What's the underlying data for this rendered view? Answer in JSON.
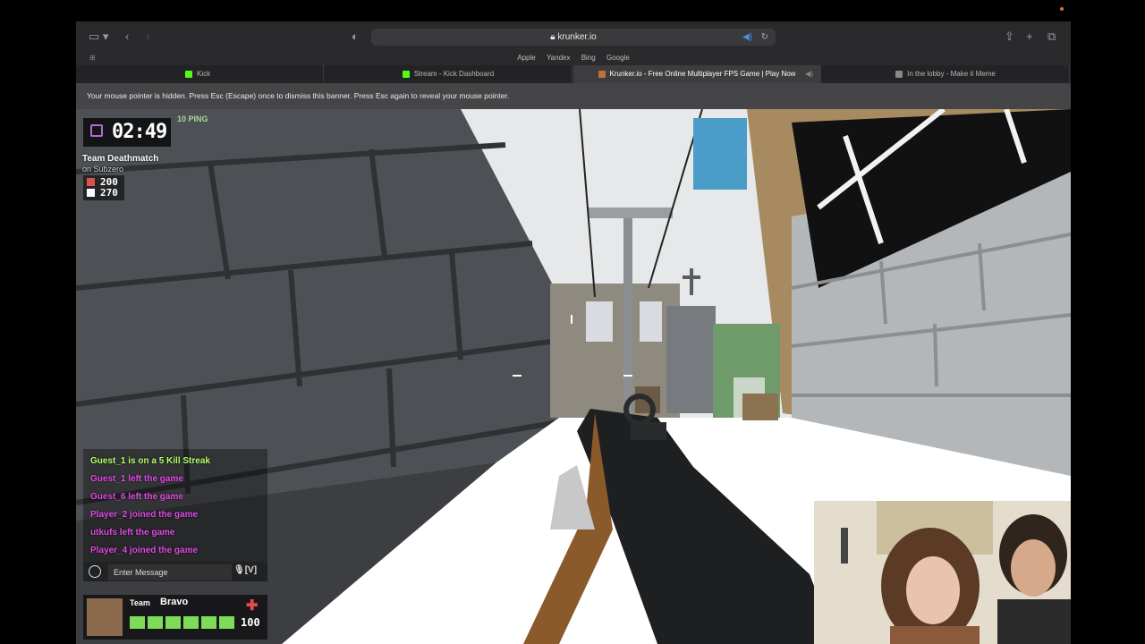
{
  "browser": {
    "url": "krunker.io",
    "favorites": [
      "Apple",
      "Yandex",
      "Bing",
      "Google"
    ],
    "tabs": [
      {
        "label": "Kick",
        "icon": "kick-icon",
        "active": false
      },
      {
        "label": "Stream - Kick Dashboard",
        "icon": "kick-icon",
        "active": false
      },
      {
        "label": "Krunker.io - Free Online Multiplayer FPS Game | Play Now",
        "icon": "krunker-icon",
        "active": true
      },
      {
        "label": "In the lobby - Make it Meme",
        "icon": "meme-icon",
        "active": false
      }
    ],
    "banner": "Your mouse pointer is hidden. Press Esc (Escape) once to dismiss this banner. Press Esc again to reveal your mouse pointer."
  },
  "game": {
    "timer": "02:49",
    "ping": "10 PING",
    "mode": "Team Deathmatch",
    "map": "on Subzero",
    "scores": [
      {
        "team": "red",
        "value": "200",
        "color": "#d9534f"
      },
      {
        "team": "white",
        "value": "270",
        "color": "#ffffff"
      }
    ],
    "feed": [
      {
        "text": "Guest_1 is on a 5 Kill Streak",
        "color": "#b6ff6a"
      },
      {
        "text": "Guest_1 left the game",
        "color": "#e24be6"
      },
      {
        "text": "Guest_6 left the game",
        "color": "#e24be6"
      },
      {
        "text": "Player_2 joined the game",
        "color": "#e24be6"
      },
      {
        "text": "utkufs left the game",
        "color": "#e24be6"
      },
      {
        "text": "Player_4 joined the game",
        "color": "#e24be6"
      }
    ],
    "chat_placeholder": "Enter Message",
    "mic_label": "[V]",
    "team_label": "Team",
    "team_name": "Bravo",
    "health": "100",
    "health_fraction": 1.0
  },
  "colors": {
    "accent": "#b46ad0",
    "health": "#7fdc59",
    "feed_join": "#e24be6"
  }
}
